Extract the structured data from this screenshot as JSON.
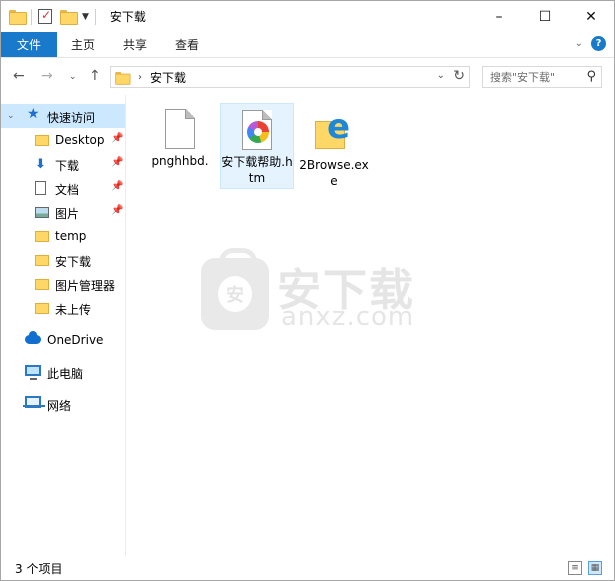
{
  "window": {
    "title": "安下载",
    "controls": [
      "–",
      "☐",
      "✕"
    ]
  },
  "ribbon": {
    "file_tab": "文件",
    "tabs": [
      "主页",
      "共享",
      "查看"
    ]
  },
  "address": {
    "crumb": "安下载",
    "search_placeholder": "搜索\"安下载\""
  },
  "nav": {
    "quick_access": "快速访问",
    "items": [
      {
        "label": "Desktop",
        "icon": "folder-icon",
        "pinned": true
      },
      {
        "label": "下载",
        "icon": "download-arrow-icon",
        "pinned": true
      },
      {
        "label": "文档",
        "icon": "document-icon",
        "pinned": true
      },
      {
        "label": "图片",
        "icon": "picture-icon",
        "pinned": true
      },
      {
        "label": "temp",
        "icon": "folder-icon",
        "pinned": false
      },
      {
        "label": "安下载",
        "icon": "folder-icon",
        "pinned": false
      },
      {
        "label": "图片管理器",
        "icon": "folder-icon",
        "pinned": false
      },
      {
        "label": "未上传",
        "icon": "folder-icon",
        "pinned": false
      }
    ],
    "onedrive": "OneDrive",
    "this_pc": "此电脑",
    "network": "网络"
  },
  "files": [
    {
      "name": "pnghhbd.",
      "icon": "blank-file-icon"
    },
    {
      "name": "安下载帮助.htm",
      "icon": "htm-file-icon"
    },
    {
      "name": "2Browse.exe",
      "icon": "edge-app-icon"
    }
  ],
  "watermark": {
    "cn": "安下载",
    "en": "anxz.com",
    "shield": "安"
  },
  "status": {
    "count": "3 个项目"
  }
}
